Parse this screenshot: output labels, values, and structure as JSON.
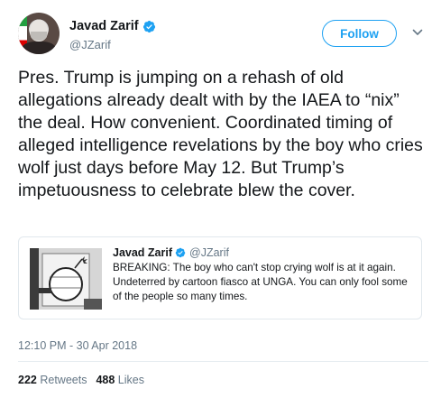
{
  "author": {
    "display_name": "Javad Zarif",
    "handle": "@JZarif",
    "verified": true,
    "verified_icon": "verified-badge-icon"
  },
  "follow": {
    "label": "Follow"
  },
  "menu": {
    "icon": "chevron-down-icon"
  },
  "tweet": {
    "text": "Pres. Trump is jumping on a rehash of old allegations already dealt with by the IAEA to “nix” the deal. How convenient. Coordinated timing of alleged intelligence revelations by the boy who cries wolf just days before May 12. But Trump’s impetuousness to celebrate blew the cover."
  },
  "quoted_tweet": {
    "display_name": "Javad Zarif",
    "handle": "@JZarif",
    "text": "BREAKING: The boy who can't stop crying wolf is at it again. Undeterred by cartoon fiasco at UNGA. You can only fool some of the people so many times."
  },
  "timestamp": "12:10 PM - 30 Apr 2018",
  "stats": {
    "retweets_count": "222",
    "retweets_label": "Retweets",
    "likes_count": "488",
    "likes_label": "Likes"
  },
  "colors": {
    "accent": "#1da1f2",
    "text": "#14171a",
    "secondary": "#657786"
  }
}
